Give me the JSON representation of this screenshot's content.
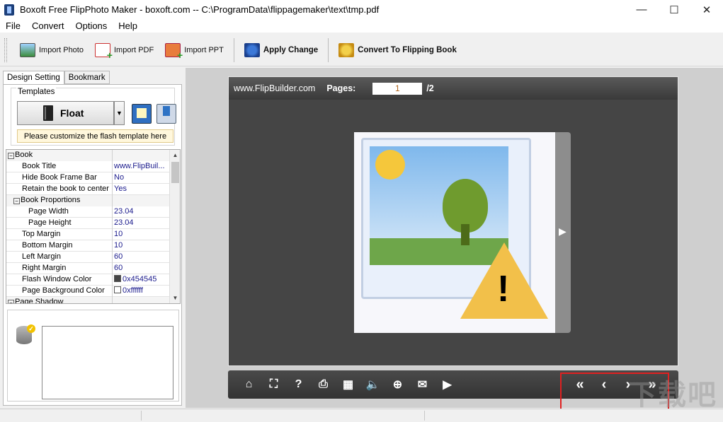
{
  "window": {
    "title": "Boxoft Free FlipPhoto Maker - boxoft.com -- C:\\ProgramData\\flippagemaker\\text\\tmp.pdf",
    "minimize_glyph": "—",
    "maximize_glyph": "☐",
    "close_glyph": "✕"
  },
  "menu": [
    "File",
    "Convert",
    "Options",
    "Help"
  ],
  "toolbar": {
    "import_photo": "Import Photo",
    "import_pdf": "Import PDF",
    "import_ppt": "Import PPT",
    "apply_change": "Apply Change",
    "convert": "Convert To Flipping Book"
  },
  "left_tabs": [
    "Design Setting",
    "Bookmark"
  ],
  "templates": {
    "group_label": "Templates",
    "selected": "Float",
    "hint": "Please customize the flash template here"
  },
  "properties": [
    {
      "key": "Book",
      "value": "",
      "level": 0,
      "toggle": "⊟"
    },
    {
      "key": "Book Title",
      "value": "www.FlipBuil...",
      "level": 1
    },
    {
      "key": "Hide Book Frame Bar",
      "value": "No",
      "level": 1
    },
    {
      "key": "Retain the book to center",
      "value": "Yes",
      "level": 1
    },
    {
      "key": "Book Proportions",
      "value": "",
      "level": 1,
      "toggle": "⊟"
    },
    {
      "key": "Page Width",
      "value": "23.04",
      "level": 2
    },
    {
      "key": "Page Height",
      "value": "23.04",
      "level": 2
    },
    {
      "key": "Top Margin",
      "value": "10",
      "level": 1
    },
    {
      "key": "Bottom Margin",
      "value": "10",
      "level": 1
    },
    {
      "key": "Left Margin",
      "value": "60",
      "level": 1
    },
    {
      "key": "Right Margin",
      "value": "60",
      "level": 1
    },
    {
      "key": "Flash Window Color",
      "value": "0x454545",
      "level": 1,
      "swatch": "#454545"
    },
    {
      "key": "Page Background Color",
      "value": "0xffffff",
      "level": 1,
      "swatch": "#ffffff"
    },
    {
      "key": "Page Shadow",
      "value": "",
      "level": 0,
      "toggle": "⊟"
    }
  ],
  "viewer": {
    "site": "www.FlipBuilder.com",
    "pages_label": "Pages:",
    "current_page": "1",
    "total_pages": "/2",
    "window_color": "#454545",
    "bottom_icons": [
      "home-icon",
      "fit-screen-icon",
      "help-icon",
      "print-icon",
      "thumbnails-icon",
      "sound-icon",
      "zoom-icon",
      "email-icon",
      "autoplay-icon"
    ],
    "bottom_glyphs": [
      "⌂",
      "⛶",
      "?",
      "⎙",
      "▦",
      "🔈",
      "⊕",
      "✉",
      "▶"
    ],
    "nav_glyphs": [
      "«",
      "‹",
      "›",
      "»"
    ]
  },
  "watermark": "下载吧"
}
